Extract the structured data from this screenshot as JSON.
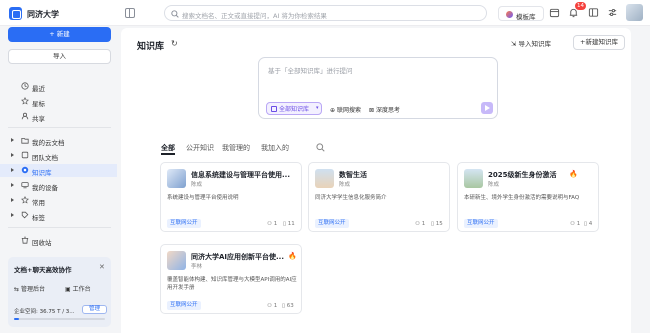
{
  "app": {
    "name": "同济大学"
  },
  "search": {
    "placeholder": "搜索文档名、正文或直接提问，AI 将为你检索结果"
  },
  "topbar": {
    "template_label": "模板库",
    "notification_count": "14"
  },
  "sidebar": {
    "new_label": "+ 新建",
    "import_label": "导入",
    "items": [
      {
        "label": "最近",
        "icon": "clock-icon"
      },
      {
        "label": "星标",
        "icon": "star-icon"
      },
      {
        "label": "共享",
        "icon": "share-icon"
      },
      {
        "label": "我的云文档",
        "icon": "folder-icon"
      },
      {
        "label": "团队文档",
        "icon": "team-icon"
      },
      {
        "label": "知识库",
        "icon": "knowledge-icon"
      },
      {
        "label": "我的设备",
        "icon": "device-icon"
      },
      {
        "label": "常用",
        "icon": "frequent-icon"
      },
      {
        "label": "标签",
        "icon": "tag-icon"
      },
      {
        "label": "回收站",
        "icon": "trash-icon"
      }
    ],
    "active_item": "知识库",
    "promo": {
      "title": "文档+聊天高效协作",
      "link1": "管理后台",
      "link2": "工作台",
      "storage": "企业空间: 36.75 T / 3...",
      "manage": "管理",
      "usage_fraction": 0.05
    }
  },
  "main": {
    "title": "知识库",
    "import_label": "导入知识库",
    "new_label": "+新建知识库",
    "query": {
      "placeholder": "基于「全部知识库」进行提问",
      "scope": "全部知识库",
      "web_search": "联网搜索",
      "deep_think": "深度思考"
    },
    "tabs": [
      "全部",
      "公开知识",
      "我管理的",
      "我加入的"
    ],
    "cards": [
      {
        "name": "信息系统建设与管理平台使用...",
        "owner": "陈成",
        "desc": "系统建设与管理平台使用说明",
        "tag": "互联网公开",
        "members": "1",
        "docs": "11",
        "hot": false
      },
      {
        "name": "数智生活",
        "owner": "陈成",
        "desc": "同济大学学生信息化服务简介",
        "tag": "互联网公开",
        "members": "1",
        "docs": "15",
        "hot": false
      },
      {
        "name": "2025级新生身份激活",
        "owner": "陈成",
        "desc": "本研新生、境外学生身份激活的需要说明与FAQ",
        "tag": "互联网公开",
        "members": "1",
        "docs": "4",
        "hot": true
      },
      {
        "name": "同济大学AI应用创新平台使...",
        "owner": "李林",
        "desc": "覆盖智能体构建、知识库管理与大模型API调用的AI应用开发手册",
        "tag": "互联网公开",
        "members": "1",
        "docs": "63",
        "hot": true
      }
    ]
  },
  "colors": {
    "accent": "#2a6df4",
    "purple": "#6b4ce6",
    "fire": "#ff6a1a"
  }
}
